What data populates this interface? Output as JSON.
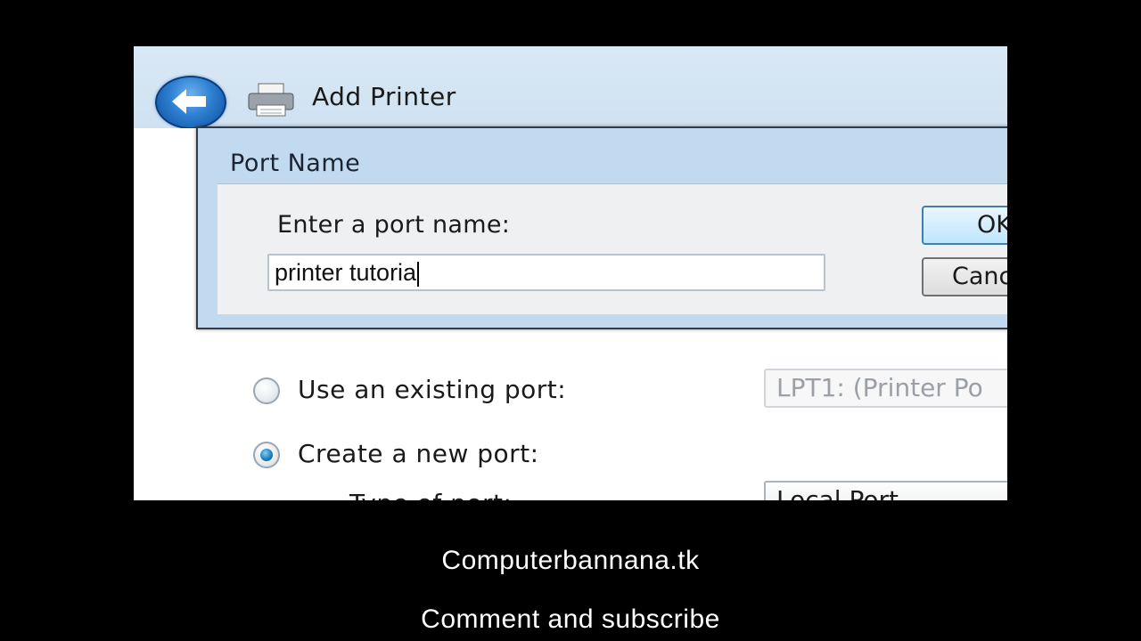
{
  "wizard": {
    "title": "Add Printer",
    "back_icon": "back-arrow-icon",
    "printer_icon": "printer-icon"
  },
  "port_options": {
    "existing_label": "Use an existing port:",
    "existing_value": "LPT1: (Printer Po",
    "existing_selected": false,
    "new_label": "Create a new port:",
    "new_selected": true,
    "type_label": "Type of port:",
    "type_value": "Local Port"
  },
  "dialog": {
    "title": "Port Name",
    "prompt": "Enter a port name:",
    "input_value": "printer tutoria",
    "ok_label": "OK",
    "cancel_label": "Cancel"
  },
  "footer": {
    "site": "Computerbannana.tk",
    "cta": "Comment and subscribe"
  },
  "colors": {
    "header": "#d2e3f2",
    "dialog_frame": "#c2daf0",
    "accent": "#1f7fc0"
  }
}
